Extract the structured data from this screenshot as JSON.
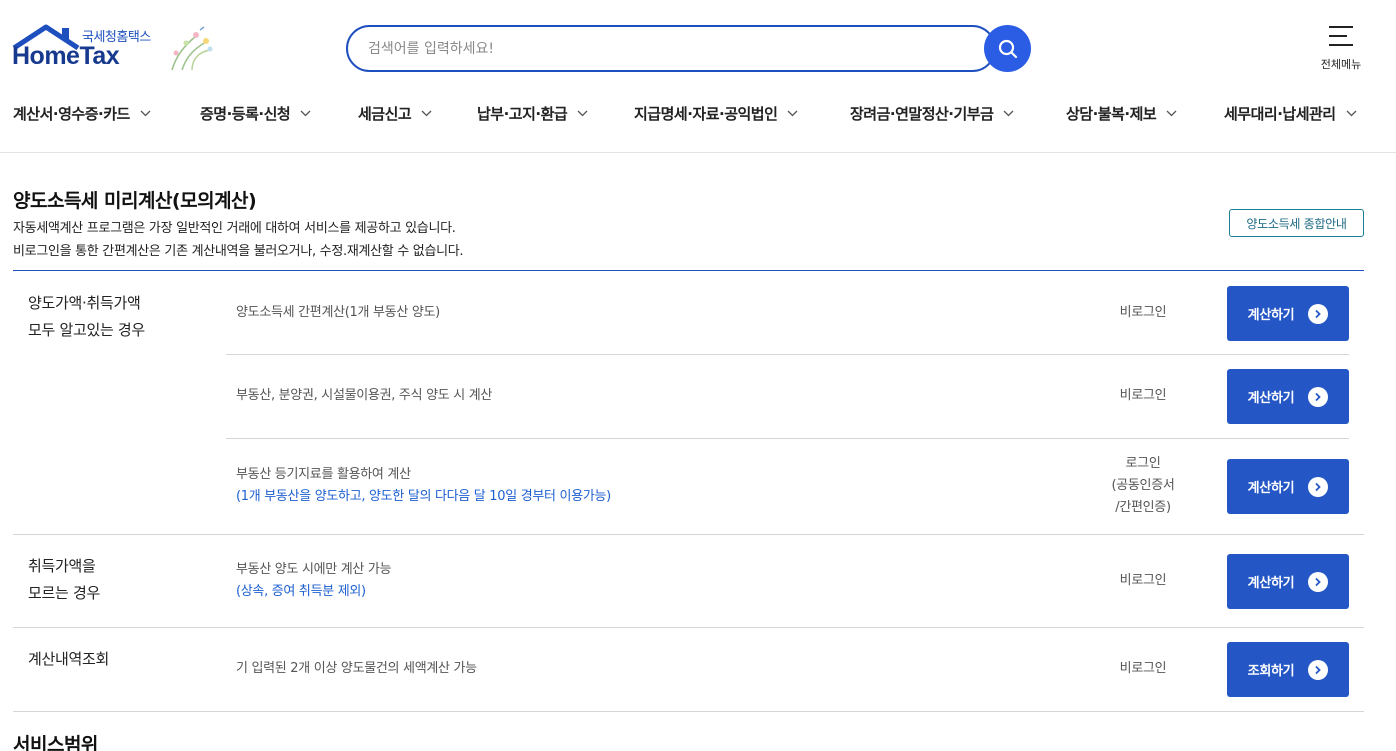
{
  "header": {
    "logo_sub": "국세청홈택스",
    "logo_main": "HomeTax",
    "search_placeholder": "검색어를 입력하세요!",
    "all_menu_label": "전체메뉴",
    "nav": [
      "계산서·영수증·카드",
      "증명·등록·신청",
      "세금신고",
      "납부·고지·환급",
      "지급명세·자료·공익법인",
      "장려금·연말정산·기부금",
      "상담·불복·제보",
      "세무대리·납세관리"
    ]
  },
  "page": {
    "title": "양도소득세 미리계산(모의계산)",
    "desc1": "자동세액계산 프로그램은 가장 일반적인 거래에 대하여 서비스를 제공하고 있습니다.",
    "desc2": "비로그인을 통한 간편계산은 기존 계산내역을 불러오거나, 수정.재계산할 수 없습니다.",
    "guide_button": "양도소득세 종합안내",
    "groups": [
      {
        "line1": "양도가액·취득가액",
        "line2": "모두 알고있는 경우"
      },
      {
        "line1": "취득가액을",
        "line2": "모르는 경우"
      },
      {
        "line1": "계산내역조회",
        "line2": ""
      }
    ],
    "rows": [
      {
        "text": "양도소득세 간편계산(1개 부동산 양도)",
        "note": "",
        "login": [
          "비로그인"
        ],
        "button": "계산하기"
      },
      {
        "text": "부동산, 분양권, 시설물이용권, 주식 양도 시 계산",
        "note": "",
        "login": [
          "비로그인"
        ],
        "button": "계산하기"
      },
      {
        "text": "부동산 등기지료를 활용하여 계산",
        "note": "(1개 부동산을 양도하고, 양도한 달의 다다음 달 10일 경부터 이용가능)",
        "login": [
          "로그인",
          "(공동인증서",
          "/간편인증)"
        ],
        "button": "계산하기"
      },
      {
        "text": "부동산 양도 시에만 계산 가능",
        "note": "(상속, 증여 취득분 제외)",
        "login": [
          "비로그인"
        ],
        "button": "계산하기"
      },
      {
        "text": "기 입력된 2개 이상 양도물건의 세액계산 가능",
        "note": "",
        "login": [
          "비로그인"
        ],
        "button": "조회하기"
      }
    ],
    "section2_title": "서비스범위"
  },
  "colors": {
    "brand_blue": "#1d4fbf",
    "button_blue": "#2457c5",
    "link_blue": "#1d5fd0",
    "guide_teal": "#1d6a84"
  }
}
